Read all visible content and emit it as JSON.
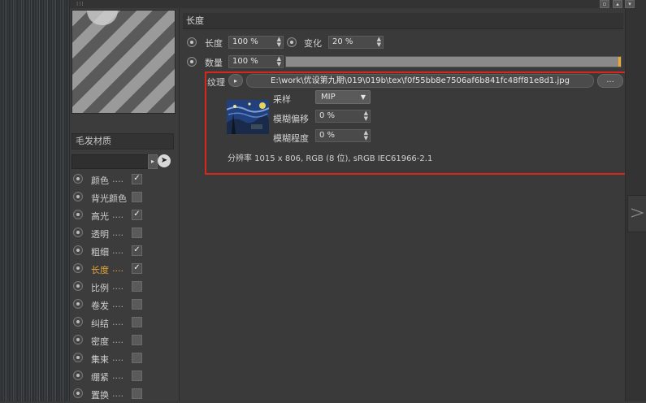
{
  "material_name": "毛发材质",
  "channels": [
    {
      "label": "颜色",
      "dots": "....",
      "checked": true,
      "active": false
    },
    {
      "label": "背光颜色",
      "dots": "",
      "checked": false,
      "active": false
    },
    {
      "label": "高光",
      "dots": "....",
      "checked": true,
      "active": false
    },
    {
      "label": "透明",
      "dots": "....",
      "checked": false,
      "active": false
    },
    {
      "label": "粗细",
      "dots": "....",
      "checked": true,
      "active": false
    },
    {
      "label": "长度",
      "dots": "....",
      "checked": true,
      "active": true
    },
    {
      "label": "比例",
      "dots": "....",
      "checked": false,
      "active": false
    },
    {
      "label": "卷发",
      "dots": "....",
      "checked": false,
      "active": false
    },
    {
      "label": "纠结",
      "dots": "....",
      "checked": false,
      "active": false
    },
    {
      "label": "密度",
      "dots": "....",
      "checked": false,
      "active": false
    },
    {
      "label": "集束",
      "dots": "....",
      "checked": false,
      "active": false
    },
    {
      "label": "绷紧",
      "dots": "....",
      "checked": false,
      "active": false
    },
    {
      "label": "置换",
      "dots": "....",
      "checked": false,
      "active": false
    }
  ],
  "section": {
    "title": "长度",
    "length_label": "长度",
    "length_value": "100 %",
    "variation_label": "变化",
    "variation_value": "20 %",
    "amount_label": "数量",
    "amount_value": "100 %",
    "amount_fill": 1.0
  },
  "texture": {
    "label": "纹理",
    "path": "E:\\work\\优设第九期\\019\\019b\\tex\\f0f55bb8e7506af6b841fc48ff81e8d1.jpg",
    "more_label": "...",
    "sampling_label": "采样",
    "sampling_value": "MIP",
    "blur_offset_label": "模糊偏移",
    "blur_offset_value": "0 %",
    "blur_scale_label": "模糊程度",
    "blur_scale_value": "0 %",
    "resolution": "分辨率 1015 x 806, RGB (8 位), sRGB IEC61966-2.1"
  },
  "colors": {
    "accent_orange": "#e3a43a",
    "highlight_red": "#d9261c"
  }
}
